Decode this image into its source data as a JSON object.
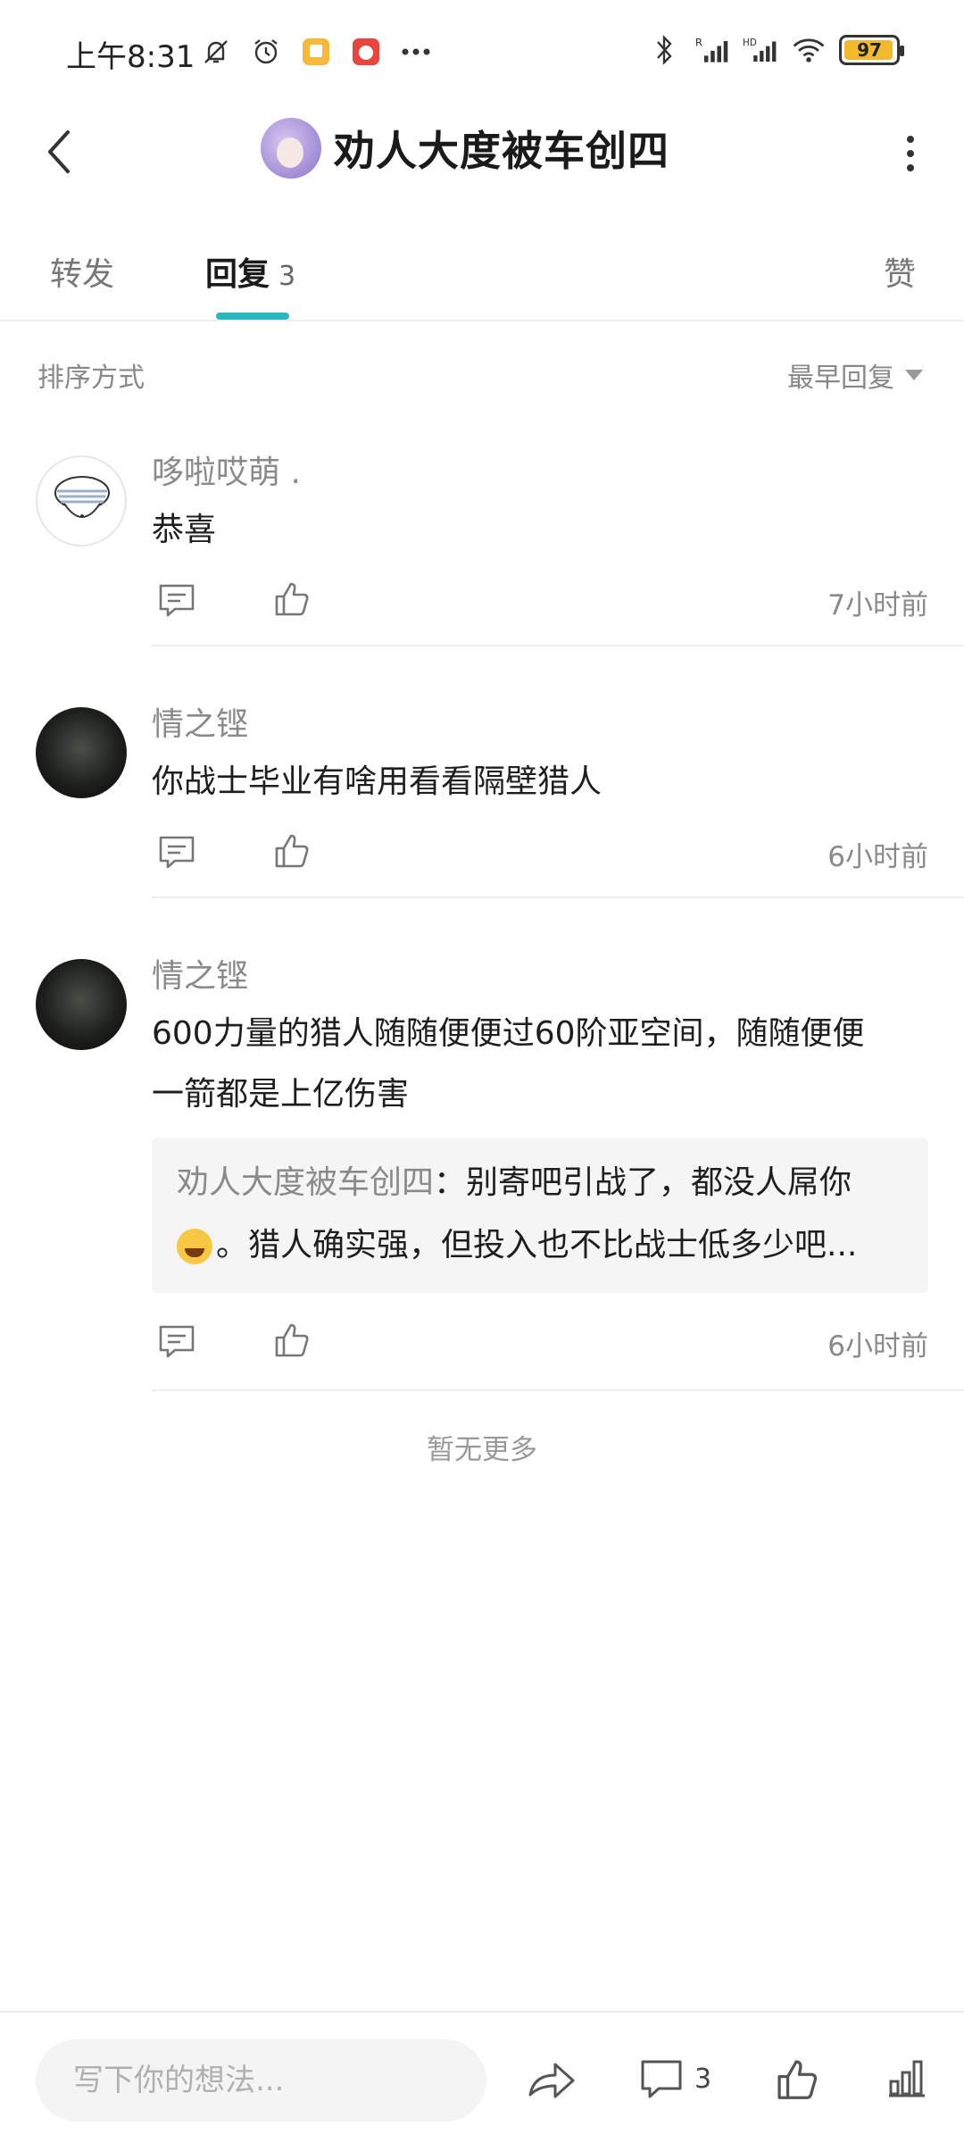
{
  "status_bar": {
    "time": "上午8:31",
    "battery": "97",
    "icons": [
      "mute-bell-icon",
      "alarm-icon",
      "app-notification-icon",
      "app-notification-icon-2",
      "more-dots-icon",
      "bluetooth-icon",
      "signal-r-icon",
      "signal-hd-icon",
      "wifi-icon",
      "battery-icon"
    ]
  },
  "header": {
    "title": "劝人大度被车创四",
    "back_icon": "chevron-left-icon",
    "more_icon": "more-vertical-icon"
  },
  "tabs": {
    "forward": "转发",
    "reply": "回复",
    "reply_count": "3",
    "like": "赞",
    "active": "reply",
    "accent_color": "#2bb7c0"
  },
  "sort": {
    "label": "排序方式",
    "value": "最早回复"
  },
  "comments": [
    {
      "name": "哆啦哎萌 .",
      "text": "恭喜",
      "time": "7小时前"
    },
    {
      "name": "情之铿",
      "text": "你战士毕业有啥用看看隔壁猎人",
      "time": "6小时前"
    },
    {
      "name": "情之铿",
      "text_line1": "600力量的猎人随随便便过60阶亚空间，随随便便",
      "text_line2": "一箭都是上亿伤害",
      "quote": {
        "author": "劝人大度被车创四",
        "line1": "：别寄吧引战了，都没人屌你",
        "line2": "。猎人确实强，但投入也不比战士低多少吧..."
      },
      "time": "6小时前"
    }
  ],
  "no_more": "暂无更多",
  "bottom_bar": {
    "input_placeholder": "写下你的想法...",
    "comment_count": "3"
  }
}
